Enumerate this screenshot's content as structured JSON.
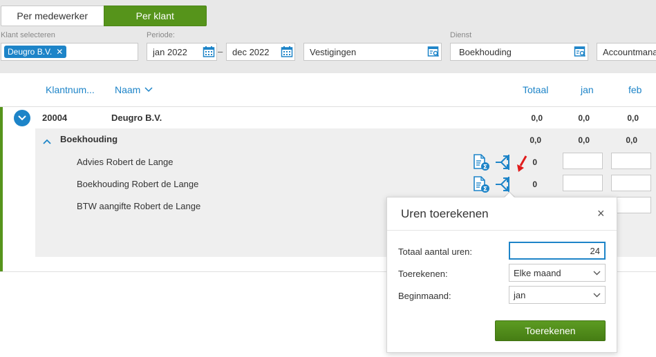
{
  "toggle": {
    "per_employee": "Per medewerker",
    "per_client": "Per klant"
  },
  "filters": {
    "client_label": "Klant selecteren",
    "client_tag": "Deugro B.V.",
    "period_label": "Periode:",
    "period_from": "jan 2022",
    "period_sep": "–",
    "period_to": "dec 2022",
    "location_value": "Vestigingen",
    "service_label": "Dienst",
    "service_value": "Boekhouding",
    "extra_value": "Accountmana"
  },
  "table": {
    "col_clientnum": "Klantnum...",
    "col_name": "Naam",
    "col_total": "Totaal",
    "col_jan": "jan",
    "col_feb": "feb"
  },
  "client": {
    "number": "20004",
    "name": "Deugro B.V.",
    "total": "0,0",
    "jan": "0,0",
    "feb": "0,0"
  },
  "service": {
    "name": "Boekhouding",
    "total": "0,0",
    "jan": "0,0",
    "feb": "0,0"
  },
  "tasks": [
    {
      "name": "Advies Robert de Lange",
      "total": "0"
    },
    {
      "name": "Boekhouding Robert de Lange",
      "total": "0"
    },
    {
      "name": "BTW aangifte Robert de Lange"
    }
  ],
  "popup": {
    "title": "Uren toerekenen",
    "close": "×",
    "total_hours_label": "Totaal aantal uren:",
    "total_hours_value": "24",
    "allocate_label": "Toerekenen:",
    "allocate_value": "Elke maand",
    "start_month_label": "Beginmaand:",
    "start_month_value": "jan",
    "submit": "Toerekenen"
  },
  "colors": {
    "accent": "#1d84c8",
    "green": "#56941b",
    "arrow": "#e01b1b"
  }
}
